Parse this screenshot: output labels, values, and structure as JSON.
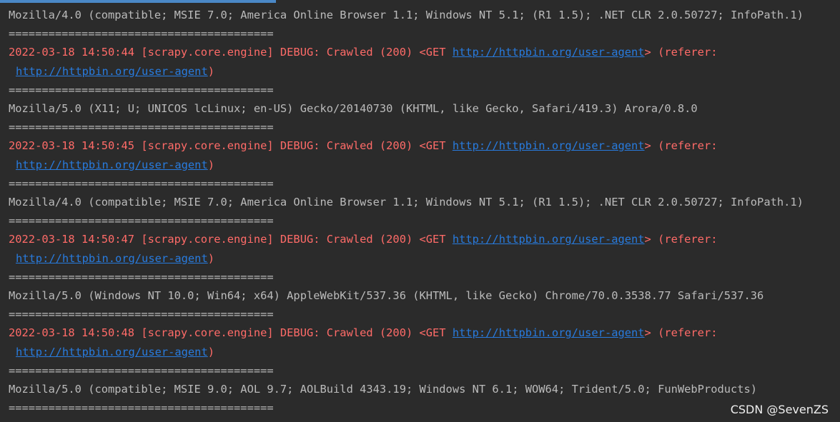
{
  "console": {
    "separator": "========================================",
    "lines": [
      {
        "kind": "plain",
        "text": "Mozilla/4.0 (compatible; MSIE 7.0; America Online Browser 1.1; Windows NT 5.1; (R1 1.5); .NET CLR 2.0.50727; InfoPath.1)"
      },
      {
        "kind": "separator"
      },
      {
        "kind": "log",
        "prefix": "2022-03-18 14:50:44 [scrapy.core.engine] DEBUG: Crawled (200) <GET ",
        "link": "http://httpbin.org/user-agent",
        "suffix": "> (referer:"
      },
      {
        "kind": "cont",
        "link": "http://httpbin.org/user-agent",
        "suffix": ")"
      },
      {
        "kind": "separator"
      },
      {
        "kind": "plain",
        "text": "Mozilla/5.0 (X11; U; UNICOS lcLinux; en-US) Gecko/20140730 (KHTML, like Gecko, Safari/419.3) Arora/0.8.0"
      },
      {
        "kind": "separator"
      },
      {
        "kind": "log",
        "prefix": "2022-03-18 14:50:45 [scrapy.core.engine] DEBUG: Crawled (200) <GET ",
        "link": "http://httpbin.org/user-agent",
        "suffix": "> (referer:"
      },
      {
        "kind": "cont",
        "link": "http://httpbin.org/user-agent",
        "suffix": ")"
      },
      {
        "kind": "separator"
      },
      {
        "kind": "plain",
        "text": "Mozilla/4.0 (compatible; MSIE 7.0; America Online Browser 1.1; Windows NT 5.1; (R1 1.5); .NET CLR 2.0.50727; InfoPath.1)"
      },
      {
        "kind": "separator"
      },
      {
        "kind": "log",
        "prefix": "2022-03-18 14:50:47 [scrapy.core.engine] DEBUG: Crawled (200) <GET ",
        "link": "http://httpbin.org/user-agent",
        "suffix": "> (referer:"
      },
      {
        "kind": "cont",
        "link": "http://httpbin.org/user-agent",
        "suffix": ")"
      },
      {
        "kind": "separator"
      },
      {
        "kind": "plain",
        "text": "Mozilla/5.0 (Windows NT 10.0; Win64; x64) AppleWebKit/537.36 (KHTML, like Gecko) Chrome/70.0.3538.77 Safari/537.36"
      },
      {
        "kind": "separator"
      },
      {
        "kind": "log",
        "prefix": "2022-03-18 14:50:48 [scrapy.core.engine] DEBUG: Crawled (200) <GET ",
        "link": "http://httpbin.org/user-agent",
        "suffix": "> (referer:"
      },
      {
        "kind": "cont",
        "link": "http://httpbin.org/user-agent",
        "suffix": ")"
      },
      {
        "kind": "separator"
      },
      {
        "kind": "plain",
        "text": "Mozilla/5.0 (compatible; MSIE 9.0; AOL 9.7; AOLBuild 4343.19; Windows NT 6.1; WOW64; Trident/5.0; FunWebProducts)"
      },
      {
        "kind": "separator"
      }
    ]
  },
  "watermark": "CSDN @SevenZS",
  "colors": {
    "background": "#2b2b2b",
    "plain_text": "#bbbbbb",
    "error_text": "#ff6b68",
    "link": "#287bde",
    "top_indicator": "#4a88c7"
  }
}
